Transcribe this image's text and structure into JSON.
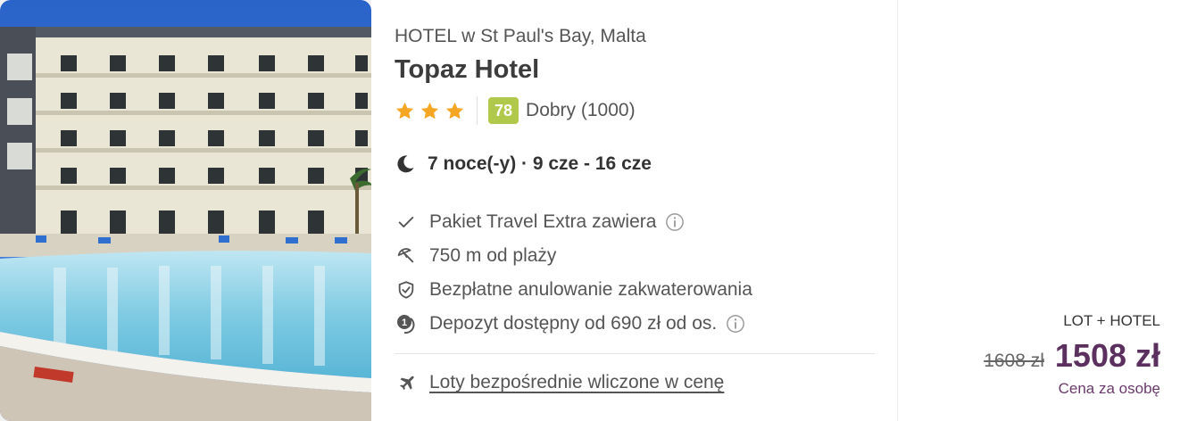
{
  "hotel": {
    "location": "HOTEL w St Paul's Bay, Malta",
    "name": "Topaz Hotel",
    "stars": 3,
    "score": "78",
    "rating_text": "Dobry (1000)"
  },
  "stay": {
    "dates": "7 noce(-y) · 9 cze - 16 cze"
  },
  "features": [
    {
      "icon": "check-icon",
      "text": "Pakiet Travel Extra zawiera",
      "info": true
    },
    {
      "icon": "beach-umbrella-icon",
      "text": "750 m od plaży",
      "info": false
    },
    {
      "icon": "shield-check-icon",
      "text": "Bezpłatne anulowanie zakwaterowania",
      "info": false
    },
    {
      "icon": "deposit-icon",
      "text": "Depozyt dostępny od 690 zł od os.",
      "info": true
    }
  ],
  "flights": {
    "icon": "airplane-icon",
    "text": "Loty bezpośrednie wliczone w cenę"
  },
  "price": {
    "package": "LOT + HOTEL",
    "old": "1608 zł",
    "new": "1508 zł",
    "per_person": "Cena za osobę"
  },
  "colors": {
    "star": "#f5a623",
    "score_bg": "#b1c94a",
    "price": "#5b2f5e"
  }
}
